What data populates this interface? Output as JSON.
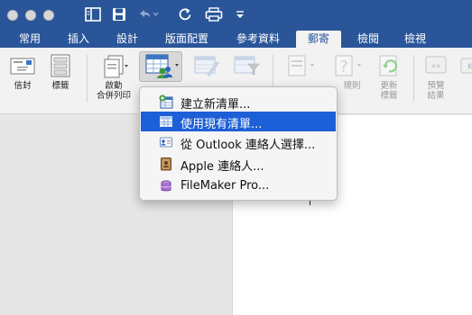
{
  "window": {
    "qat": [
      "sidebar-toggle-icon",
      "save-icon",
      "undo-icon",
      "redo-icon",
      "print-icon",
      "customize-qat-icon"
    ]
  },
  "tabs": [
    {
      "label": "常用"
    },
    {
      "label": "插入"
    },
    {
      "label": "設計"
    },
    {
      "label": "版面配置"
    },
    {
      "label": "參考資料"
    },
    {
      "label": "郵寄",
      "active": true
    },
    {
      "label": "檢閱"
    },
    {
      "label": "檢視"
    }
  ],
  "ribbon": {
    "envelopes": "信封",
    "labels": "標籤",
    "start_mail_merge": "啟動\n合併列印",
    "rules": "規則",
    "update_labels": "更新\n標籤",
    "preview_results": "預覽\n結果"
  },
  "menu": {
    "items": [
      {
        "label": "建立新清單...",
        "icon": "new-list-icon"
      },
      {
        "label": "使用現有清單...",
        "icon": "table-icon",
        "highlighted": true
      },
      {
        "label": "從 Outlook 連絡人選擇...",
        "icon": "contact-card-icon"
      },
      {
        "label": "Apple 連絡人...",
        "icon": "address-book-icon"
      },
      {
        "label": "FileMaker Pro...",
        "icon": "database-icon"
      }
    ]
  },
  "colors": {
    "title_bar": "#2a5699",
    "highlight": "#1d5fd6"
  }
}
